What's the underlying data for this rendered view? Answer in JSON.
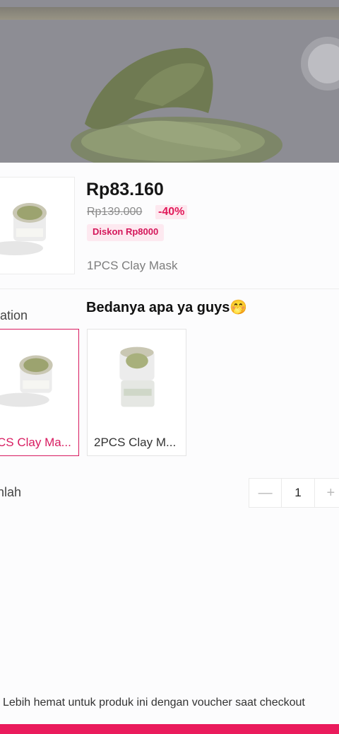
{
  "product": {
    "price": "Rp83.160",
    "original_price": "Rp139.000",
    "discount_percent": "-40%",
    "discount_badge": "Diskon Rp8000",
    "selected_variant": "1PCS Clay Mask"
  },
  "caption": "Bedanya apa ya guys🤭",
  "variation": {
    "label": "iation",
    "options": [
      {
        "label": "CS Clay Ma...",
        "selected": true
      },
      {
        "label": "2PCS Clay M...",
        "selected": false
      }
    ]
  },
  "quantity": {
    "label": "nlah",
    "value": "1",
    "minus": "—",
    "plus": "+"
  },
  "voucher_note": "Lebih hemat  untuk produk ini dengan voucher saat checkout",
  "colors": {
    "accent": "#ea1b5c",
    "discount_text": "#e11a5a",
    "hero_bg": "#8d8d94"
  }
}
